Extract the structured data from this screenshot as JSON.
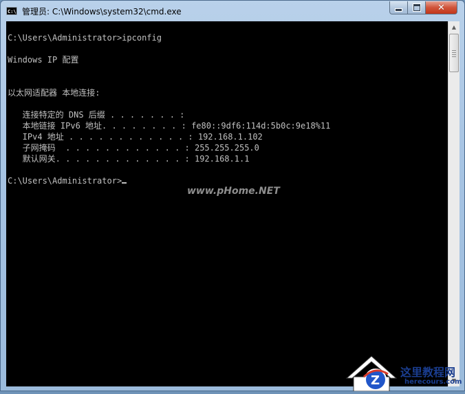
{
  "window": {
    "title": "管理员: C:\\Windows\\system32\\cmd.exe",
    "icon": "cmd-icon",
    "controls": {
      "minimize": "minimize-icon",
      "maximize": "maximize-icon",
      "close": "close-icon"
    }
  },
  "console": {
    "lines": [
      "C:\\Users\\Administrator>ipconfig",
      "",
      "Windows IP 配置",
      "",
      "",
      "以太网适配器 本地连接:",
      "",
      "   连接特定的 DNS 后缀 . . . . . . . :",
      "   本地链接 IPv6 地址. . . . . . . . : fe80::9df6:114d:5b0c:9e18%11",
      "   IPv4 地址 . . . . . . . . . . . . : 192.168.1.102",
      "   子网掩码  . . . . . . . . . . . . : 255.255.255.0",
      "   默认网关. . . . . . . . . . . . . : 192.168.1.1",
      "",
      "C:\\Users\\Administrator>"
    ],
    "text_color": "#c0c0c0",
    "background": "#000000"
  },
  "watermark": "www.pHome.NET",
  "logo": {
    "text": "这里教程网",
    "sub": "herecours.com",
    "letter": "Z"
  },
  "colors": {
    "frame": "#a7c4e3",
    "close_button": "#c2361a"
  }
}
